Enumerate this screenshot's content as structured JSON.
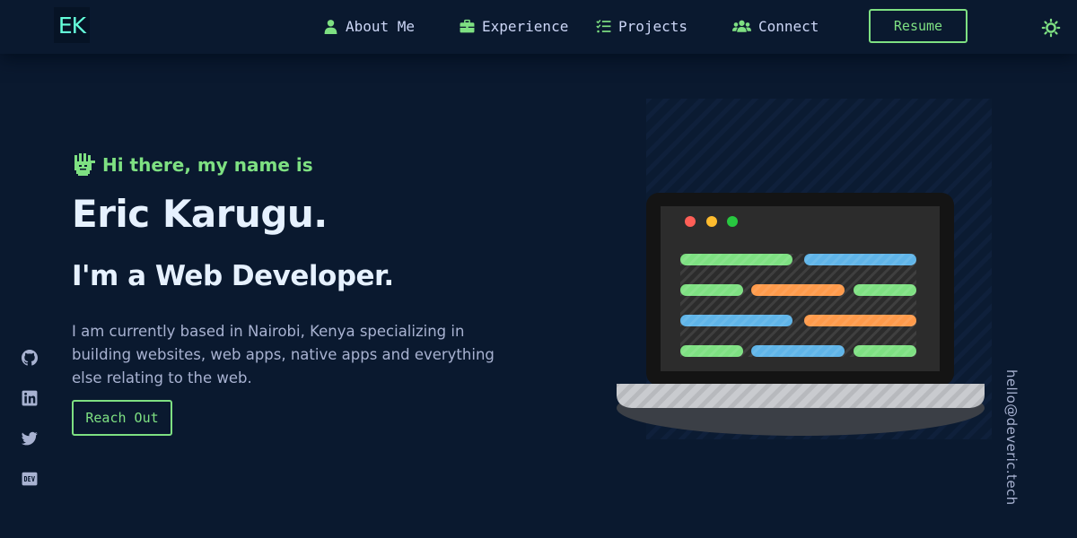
{
  "header": {
    "logo": "EK",
    "nav": [
      {
        "label": "About Me",
        "icon": "user-icon"
      },
      {
        "label": "Experience",
        "icon": "briefcase-icon"
      },
      {
        "label": "Projects",
        "icon": "checklist-icon"
      },
      {
        "label": "Connect",
        "icon": "users-icon"
      }
    ],
    "resume_label": "Resume",
    "theme_icon": "sun-icon"
  },
  "hero": {
    "greeting": "Hi there, my name is",
    "greeting_icon": "waving-hand-icon",
    "name": "Eric Karugu.",
    "role": "I'm a Web Developer.",
    "bio": "I am currently based in Nairobi, Kenya specializing in building websites, web apps, native apps and everything else relating to the web.",
    "cta_label": "Reach Out"
  },
  "socials": [
    {
      "name": "GitHub",
      "icon": "github-icon"
    },
    {
      "name": "LinkedIn",
      "icon": "linkedin-icon"
    },
    {
      "name": "Twitter",
      "icon": "twitter-icon"
    },
    {
      "name": "DEV",
      "icon": "dev-icon"
    }
  ],
  "email": "hello@deveric.tech",
  "colors": {
    "background": "#0a192f",
    "accent": "#7ee082",
    "heading": "#e6f1ff",
    "text": "#a8b2d1",
    "nav_text": "#ccd6f6",
    "code_green": "#7ee082",
    "code_blue": "#5fb4e8",
    "code_orange": "#ff9a4a"
  }
}
